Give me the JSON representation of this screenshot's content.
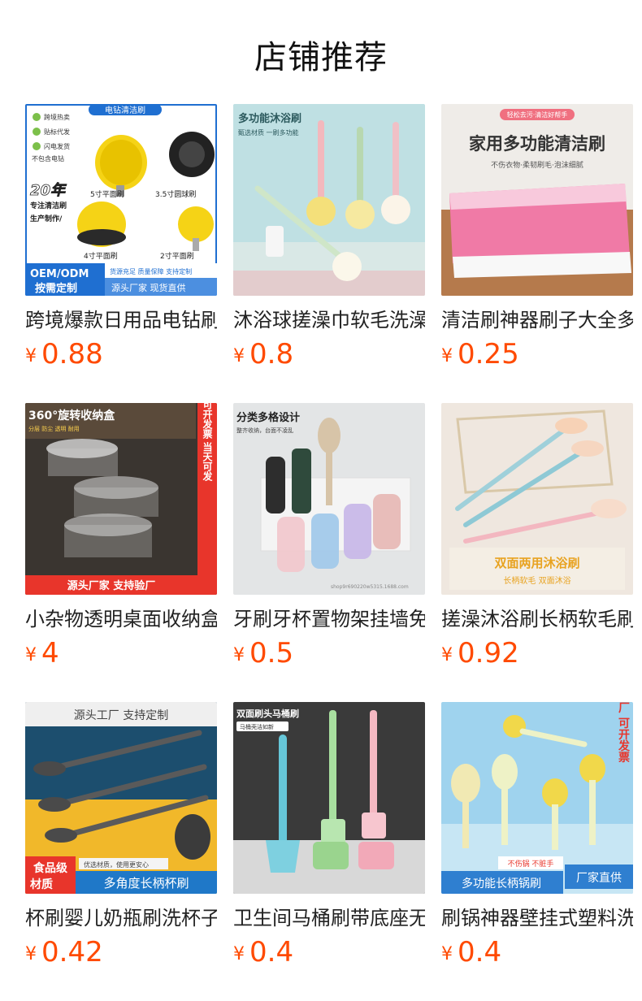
{
  "page": {
    "title": "店铺推荐",
    "currency": "¥"
  },
  "products": [
    {
      "name": "跨境爆款日用品电钻刷头清洁刷",
      "price": "0.88",
      "image": {
        "header": "电钻清洁刷",
        "bullets": [
          "跨境热卖",
          "贴标代发",
          "闪电发货"
        ],
        "note": "不包含电钻",
        "years": "20年",
        "tag1": "专注清洁刷",
        "tag2": "生产制作/",
        "labels": [
          "5寸平面刷",
          "3.5寸圆球刷",
          "4寸平面刷",
          "2寸平面刷"
        ],
        "oem": "OEM/ODM",
        "custom": "按需定制",
        "small": "货源充足 质量保障 支持定制",
        "bottom": "源头厂家 现货直供"
      }
    },
    {
      "name": "沐浴球搓澡巾软毛洗澡刷",
      "price": "0.8",
      "image": {
        "title": "多功能沐浴刷",
        "sub": "甄选材质 一刷多功能"
      }
    },
    {
      "name": "清洁刷神器刷子大全多功能",
      "price": "0.25",
      "image": {
        "badge": "轻松去污·清洁好帮手",
        "title": "家用多功能清洁刷",
        "sub": "不伤衣物·柔韧刷毛·泡沫细腻"
      }
    },
    {
      "name": "小杂物透明桌面收纳盒旋转",
      "price": "4",
      "image": {
        "title": "360°旋转收纳盒",
        "tags": "分层 防尘 透明 耐用",
        "side": "高品质定制 可开发票 当天可发",
        "bottom": "源头厂家  支持验厂"
      }
    },
    {
      "name": "牙刷牙杯置物架挂墙免打孔",
      "price": "0.5",
      "image": {
        "title": "分类多格设计",
        "sub": "整齐收纳，台面不凌乱",
        "watermark": "shop9r690220w5315.1688.com"
      }
    },
    {
      "name": "搓澡沐浴刷长柄软毛刷背",
      "price": "0.92",
      "image": {
        "title": "双面两用沐浴刷",
        "sub": "长柄软毛 双面沐浴"
      }
    },
    {
      "name": "杯刷婴儿奶瓶刷洗杯子刷",
      "price": "0.42",
      "image": {
        "top": "源头工厂  支持定制",
        "badge1": "食品级",
        "badge2": "材质",
        "small": "优选材质，使用更安心",
        "bottom": "多角度长柄杯刷"
      }
    },
    {
      "name": "卫生间马桶刷带底座无死角",
      "price": "0.4",
      "image": {
        "title": "双面刷头马桶刷",
        "sub": "马桶壳洁如新"
      }
    },
    {
      "name": "刷锅神器壁挂式塑料洗锅刷",
      "price": "0.4",
      "image": {
        "side": "支持验厂 可开发票",
        "small": "不伤锅 不脏手",
        "bottom": "多功能长柄锅刷",
        "corner": "厂家直供"
      }
    }
  ]
}
